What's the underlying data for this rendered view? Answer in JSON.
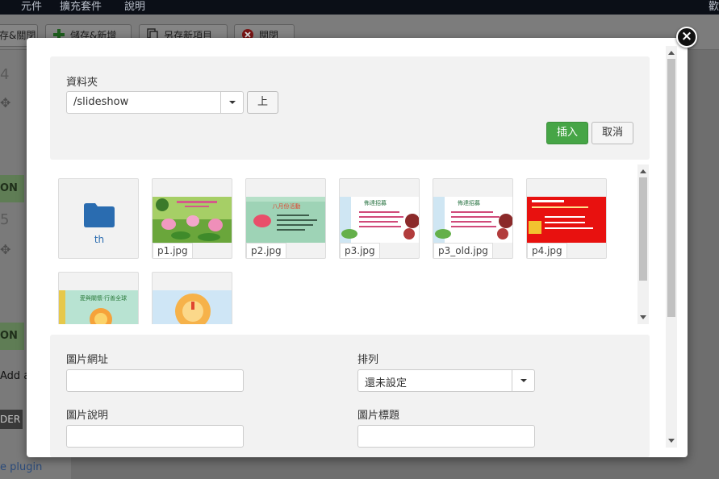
{
  "background": {
    "menu": [
      "元件",
      "擴充套件",
      "說明"
    ],
    "toolbar": {
      "save_close": "存&關閉",
      "save_new": "儲存&新增",
      "save_copy": "另存新項目",
      "close": "關閉"
    },
    "left_column": {
      "num1": "4",
      "num2": "5",
      "on1": "ON",
      "on2": "ON",
      "add_text": "Add a",
      "der_text": "DER",
      "plugin_text": "e plugin"
    },
    "right_edge_char": "歡"
  },
  "modal": {
    "close_icon": "×",
    "folder": {
      "label": "資料夾",
      "current": "/slideshow",
      "up_button": "上",
      "insert_button": "插入",
      "cancel_button": "取消"
    },
    "gallery": {
      "folders": [
        {
          "name": "th"
        }
      ],
      "images": [
        {
          "file": "p1.jpg",
          "banner_text": ""
        },
        {
          "file": "p2.jpg",
          "banner_text": "八月份活動"
        },
        {
          "file": "p3.jpg",
          "banner_text": "佈達招募"
        },
        {
          "file": "p3_old.jpg",
          "banner_text": "佈達招募"
        },
        {
          "file": "p4.jpg",
          "banner_text": ""
        },
        {
          "file": "",
          "banner_text": "愛與關懷·行善全球"
        },
        {
          "file": "",
          "banner_text": ""
        }
      ]
    },
    "form": {
      "image_url_label": "圖片網址",
      "image_url_value": "",
      "align_label": "排列",
      "align_value": "還未設定",
      "description_label": "圖片說明",
      "description_value": "",
      "title_label": "圖片標題",
      "title_value": ""
    }
  },
  "colors": {
    "accent_green": "#46a546",
    "folder_blue": "#2a6cb0",
    "p4_red": "#e8110f"
  }
}
